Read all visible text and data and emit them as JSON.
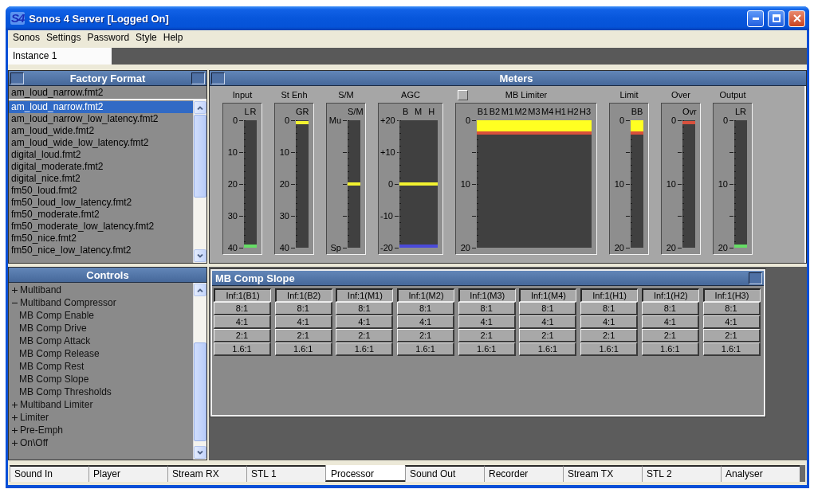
{
  "window": {
    "logo": "S4",
    "title": "Sonos 4 Server [Logged On]"
  },
  "menu": [
    "Sonos",
    "Settings",
    "Password",
    "Style",
    "Help"
  ],
  "instance_tabs": [
    {
      "label": "Instance 1",
      "selected": true
    }
  ],
  "factory_format": {
    "title": "Factory Format",
    "current": "am_loud_narrow.fmt2",
    "items": [
      {
        "label": "am_loud_narrow.fmt2",
        "selected": true
      },
      {
        "label": "am_loud_narrow_low_latency.fmt2",
        "selected": false
      },
      {
        "label": "am_loud_wide.fmt2",
        "selected": false
      },
      {
        "label": "am_loud_wide_low_latency.fmt2",
        "selected": false
      },
      {
        "label": "digital_loud.fmt2",
        "selected": false
      },
      {
        "label": "digital_moderate.fmt2",
        "selected": false
      },
      {
        "label": "digital_nice.fmt2",
        "selected": false
      },
      {
        "label": "fm50_loud.fmt2",
        "selected": false
      },
      {
        "label": "fm50_loud_low_latency.fmt2",
        "selected": false
      },
      {
        "label": "fm50_moderate.fmt2",
        "selected": false
      },
      {
        "label": "fm50_moderate_low_latency.fmt2",
        "selected": false
      },
      {
        "label": "fm50_nice.fmt2",
        "selected": false
      },
      {
        "label": "fm50_nice_low_latency.fmt2",
        "selected": false
      }
    ]
  },
  "controls": {
    "title": "Controls",
    "items": [
      {
        "label": "Multiband",
        "expanded": false
      },
      {
        "label": "Multiband Compressor",
        "expanded": true,
        "children": [
          {
            "label": "MB Comp Enable"
          },
          {
            "label": "MB Comp Drive"
          },
          {
            "label": "MB Comp Attack"
          },
          {
            "label": "MB Comp Release"
          },
          {
            "label": "MB Comp Rest"
          },
          {
            "label": "MB Comp Slope"
          },
          {
            "label": "MB Comp Thresholds"
          }
        ]
      },
      {
        "label": "Multiband Limiter",
        "expanded": false
      },
      {
        "label": "Limiter",
        "expanded": false
      },
      {
        "label": "Pre-Emph",
        "expanded": false
      },
      {
        "label": "On\\Off",
        "expanded": false
      }
    ]
  },
  "meters": {
    "title": "Meters",
    "groups": [
      {
        "label": "Input",
        "channels": [
          "L",
          "R"
        ],
        "scale": [
          "0",
          "10",
          "20",
          "30",
          "40"
        ],
        "indicators": [
          {
            "kind": "line",
            "level": 0.01,
            "color": "#66dd66"
          }
        ]
      },
      {
        "label": "St Enh",
        "channels": [
          "GR"
        ],
        "scale": [
          "0",
          "10",
          "20",
          "30",
          "40"
        ],
        "indicators": [
          {
            "kind": "line",
            "level": 0.98,
            "color": "#f2f230"
          }
        ]
      },
      {
        "label": "S/M",
        "channels": [
          "S/M"
        ],
        "scale": [
          "Mu",
          "Sp"
        ],
        "indicators": [
          {
            "kind": "line",
            "level": 0.5,
            "color": "#f2f230"
          }
        ]
      },
      {
        "label": "AGC",
        "channels": [
          "B",
          "M",
          "H"
        ],
        "scale": [
          "+20",
          "+10",
          "0",
          "-10",
          "-20"
        ],
        "indicators": [
          {
            "kind": "line",
            "level": 0.5,
            "color": "#f2f230"
          },
          {
            "kind": "line",
            "level": 0.01,
            "color": "#4a4ad8"
          }
        ]
      },
      {
        "label": "MB Limiter",
        "checked": false,
        "channels": [
          "B1",
          "B2",
          "M1",
          "M2",
          "M3",
          "M4",
          "H1",
          "H2",
          "H3"
        ],
        "scale": [
          "0",
          "10",
          "20"
        ],
        "indicators": [
          {
            "kind": "fill",
            "level": 0.09,
            "color": "#ffff22"
          },
          {
            "kind": "line",
            "level": 0.9,
            "color": "#d8503c"
          }
        ]
      },
      {
        "label": "Limit",
        "channels": [
          "BB"
        ],
        "scale": [
          "0",
          "10",
          "20"
        ],
        "indicators": [
          {
            "kind": "fill",
            "level": 0.09,
            "color": "#ffff22"
          },
          {
            "kind": "line",
            "level": 0.9,
            "color": "#d8503c"
          }
        ]
      },
      {
        "label": "Over",
        "channels": [
          "Ovr"
        ],
        "scale": [
          "0",
          "10",
          "20"
        ],
        "indicators": [
          {
            "kind": "line",
            "level": 0.98,
            "color": "#d8503c"
          }
        ]
      },
      {
        "label": "Output",
        "channels": [
          "LR"
        ],
        "scale": [
          "0",
          "10",
          "20"
        ],
        "indicators": [
          {
            "kind": "line",
            "level": 0.01,
            "color": "#66dd66"
          }
        ]
      }
    ]
  },
  "mb_comp_slope": {
    "title": "MB Comp Slope",
    "columns": [
      {
        "buttons": [
          {
            "label": "Inf:1(B1)",
            "selected": true
          },
          {
            "label": "8:1",
            "selected": false
          },
          {
            "label": "4:1",
            "selected": false
          },
          {
            "label": "2:1",
            "selected": false
          },
          {
            "label": "1.6:1",
            "selected": false
          }
        ]
      },
      {
        "buttons": [
          {
            "label": "Inf:1(B2)",
            "selected": true
          },
          {
            "label": "8:1",
            "selected": false
          },
          {
            "label": "4:1",
            "selected": false
          },
          {
            "label": "2:1",
            "selected": false
          },
          {
            "label": "1.6:1",
            "selected": false
          }
        ]
      },
      {
        "buttons": [
          {
            "label": "Inf:1(M1)",
            "selected": true
          },
          {
            "label": "8:1",
            "selected": false
          },
          {
            "label": "4:1",
            "selected": false
          },
          {
            "label": "2:1",
            "selected": false
          },
          {
            "label": "1.6:1",
            "selected": false
          }
        ]
      },
      {
        "buttons": [
          {
            "label": "Inf:1(M2)",
            "selected": true
          },
          {
            "label": "8:1",
            "selected": false
          },
          {
            "label": "4:1",
            "selected": false
          },
          {
            "label": "2:1",
            "selected": false
          },
          {
            "label": "1.6:1",
            "selected": false
          }
        ]
      },
      {
        "buttons": [
          {
            "label": "Inf:1(M3)",
            "selected": true
          },
          {
            "label": "8:1",
            "selected": false
          },
          {
            "label": "4:1",
            "selected": false
          },
          {
            "label": "2:1",
            "selected": false
          },
          {
            "label": "1.6:1",
            "selected": false
          }
        ]
      },
      {
        "buttons": [
          {
            "label": "Inf:1(M4)",
            "selected": true
          },
          {
            "label": "8:1",
            "selected": false
          },
          {
            "label": "4:1",
            "selected": false
          },
          {
            "label": "2:1",
            "selected": false
          },
          {
            "label": "1.6:1",
            "selected": false
          }
        ]
      },
      {
        "buttons": [
          {
            "label": "Inf:1(H1)",
            "selected": true
          },
          {
            "label": "8:1",
            "selected": false
          },
          {
            "label": "4:1",
            "selected": false
          },
          {
            "label": "2:1",
            "selected": false
          },
          {
            "label": "1.6:1",
            "selected": false
          }
        ]
      },
      {
        "buttons": [
          {
            "label": "Inf:1(H2)",
            "selected": true
          },
          {
            "label": "8:1",
            "selected": false
          },
          {
            "label": "4:1",
            "selected": false
          },
          {
            "label": "2:1",
            "selected": false
          },
          {
            "label": "1.6:1",
            "selected": false
          }
        ]
      },
      {
        "buttons": [
          {
            "label": "Inf:1(H3)",
            "selected": true
          },
          {
            "label": "8:1",
            "selected": false
          },
          {
            "label": "4:1",
            "selected": false
          },
          {
            "label": "2:1",
            "selected": false
          },
          {
            "label": "1.6:1",
            "selected": false
          }
        ]
      }
    ]
  },
  "sections": [
    {
      "label": "Sound In",
      "selected": false
    },
    {
      "label": "Player",
      "selected": false
    },
    {
      "label": "Stream RX",
      "selected": false
    },
    {
      "label": "STL 1",
      "selected": false
    },
    {
      "label": "Processor",
      "selected": true
    },
    {
      "label": "Sound Out",
      "selected": false
    },
    {
      "label": "Recorder",
      "selected": false
    },
    {
      "label": "Stream TX",
      "selected": false
    },
    {
      "label": "STL 2",
      "selected": false
    },
    {
      "label": "Analyser",
      "selected": false
    }
  ]
}
